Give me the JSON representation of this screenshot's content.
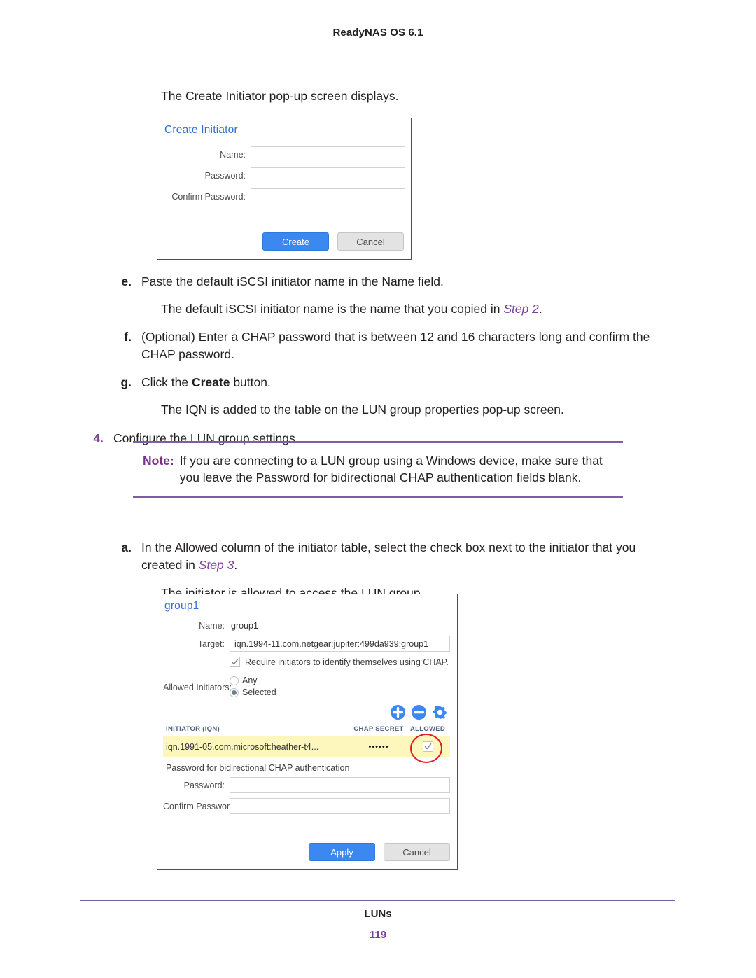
{
  "page": {
    "running_head": "ReadyNAS OS 6.1",
    "footer_title": "LUNs",
    "page_number": "119",
    "accent_purple": "#7b3f9d",
    "rule_purple": "#7b5ea7",
    "accent_blue": "#3b88f0"
  },
  "intro": {
    "caption": "The Create Initiator pop-up screen displays."
  },
  "create_initiator_dialog": {
    "title": "Create Initiator",
    "fields": [
      {
        "label": "Name:",
        "value": ""
      },
      {
        "label": "Password:",
        "value": ""
      },
      {
        "label": "Confirm Password:",
        "value": ""
      }
    ],
    "primary_button": "Create",
    "secondary_button": "Cancel"
  },
  "steps": [
    {
      "marker": "e.",
      "text": "Paste the default iSCSI initiator name in the Name field."
    },
    {
      "marker": "f.",
      "text": "(Optional) Enter a CHAP password that is between 12 and 16 characters long and confirm the CHAP password."
    },
    {
      "marker": "g.",
      "text_before": "Click the ",
      "bold": "Create",
      "text_after": " button."
    },
    {
      "marker": "4.",
      "text": "Configure the LUN group settings."
    },
    {
      "marker": "a.",
      "text_before": "In the Allowed column of the initiator table, select the check box next to the initiator that you created in ",
      "step_ref": "Step 3",
      "text_after": "."
    }
  ],
  "paragraphs": {
    "default_iqn_before": "The default iSCSI initiator name is the name that you copied in ",
    "default_iqn_step_ref": "Step 2",
    "default_iqn_after": ".",
    "iqn_added": "The IQN is added to the table on the LUN group properties pop-up screen.",
    "initiator_allowed": "The initiator is allowed to access the LUN group."
  },
  "note": {
    "label": "Note:",
    "text": "If you are connecting to a LUN group using a Windows device, make sure that you leave the Password for bidirectional CHAP authentication fields blank."
  },
  "group_dialog": {
    "title": "group1",
    "name_label": "Name:",
    "name_value": "group1",
    "target_label": "Target:",
    "target_value": "iqn.1994-11.com.netgear:jupiter:499da939:group1",
    "chap_checkbox_label": "Require initiators to identify themselves using CHAP.",
    "chap_checkbox_checked": true,
    "allowed_initiators_label": "Allowed Initiators:",
    "radio_any_label": "Any",
    "radio_selected_label": "Selected",
    "radio_selected_value": "Selected",
    "toolbar_icons": [
      "add-icon",
      "remove-icon",
      "settings-gear-icon"
    ],
    "table": {
      "columns": [
        "INITIATOR (IQN)",
        "CHAP SECRET",
        "ALLOWED"
      ],
      "rows": [
        {
          "iqn": "iqn.1991-05.com.microsoft:heather-t4...",
          "chap_secret": "••••••",
          "allowed": true
        }
      ]
    },
    "bidirectional_note": "Password for bidirectional CHAP authentication",
    "password_label": "Password:",
    "password_value": "",
    "confirm_password_label": "Confirm Password:",
    "confirm_password_value": "",
    "primary_button": "Apply",
    "secondary_button": "Cancel"
  }
}
